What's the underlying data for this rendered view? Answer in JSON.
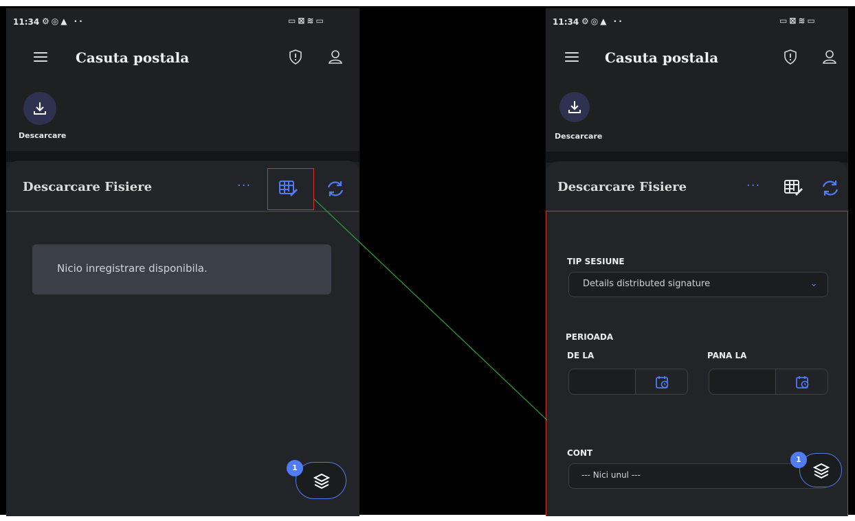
{
  "left_screen": {
    "status": {
      "time": "11:34"
    },
    "appbar": {
      "title": "Casuta postala"
    },
    "download": {
      "label": "Descarcare"
    },
    "card": {
      "title": "Descarcare Fisiere",
      "more": "···"
    },
    "empty_message": "Nicio inregistrare disponibila.",
    "fab": {
      "badge": "1"
    }
  },
  "right_screen": {
    "status": {
      "time": "11:34"
    },
    "appbar": {
      "title": "Casuta postala"
    },
    "download": {
      "label": "Descarcare"
    },
    "card": {
      "title": "Descarcare Fisiere",
      "more": "···"
    },
    "form": {
      "tip_sesiune_label": "TIP SESIUNE",
      "tip_sesiune_value": "Details distributed signature",
      "perioada_label": "PERIOADA",
      "de_la_label": "DE LA",
      "pana_la_label": "PANA LA",
      "de_la_value": "",
      "pana_la_value": "",
      "cont_label": "CONT",
      "cont_value": "--- Nici unul ---"
    },
    "fab": {
      "badge": "1"
    }
  },
  "icons": {
    "menu": "hamburger-icon",
    "shield": "shield-alert-icon",
    "user": "user-icon",
    "download": "download-icon",
    "table_edit": "table-edit-icon",
    "refresh": "refresh-icon",
    "calendar": "calendar-clock-icon",
    "layers": "layers-icon",
    "dropdown": "chevron-down-icon"
  },
  "colors": {
    "accent": "#4f7cf5",
    "highlight": "#d9342b",
    "connector": "#27a836",
    "background": "#1f2022"
  }
}
